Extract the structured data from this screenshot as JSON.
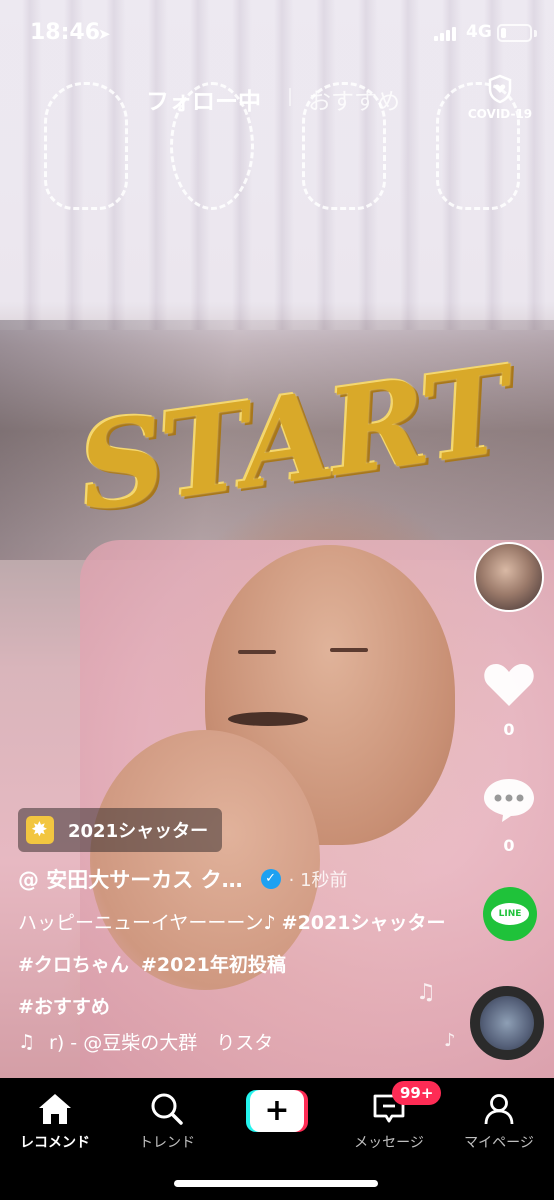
{
  "status_bar": {
    "time": "18:46",
    "network": "4G",
    "battery_level": 0.2
  },
  "top_tabs": {
    "following": "フォロー中",
    "for_you": "おすすめ"
  },
  "covid_button": {
    "label": "COVID-19"
  },
  "video": {
    "overlay_text": "START"
  },
  "actions": {
    "like_count": "0",
    "comment_count": "0",
    "share_app": "LINE"
  },
  "post": {
    "effect_label": "2021シャッター",
    "username": "@ 安田大サーカス ク…",
    "time_ago": "· 1秒前",
    "caption_text": "ハッピーニューイヤーーーン♪",
    "hashtags": [
      "#2021シャッター",
      "#クロちゃん",
      "#2021年初投稿",
      "#おすすめ"
    ],
    "sound": "r) - @豆柴の大群　りスタ"
  },
  "bottom_nav": {
    "home": "レコメンド",
    "discover": "トレンド",
    "inbox": "メッセージ",
    "profile": "マイページ",
    "inbox_badge": "99+"
  },
  "colors": {
    "like": "#ffffff",
    "line_green": "#1fc23a",
    "badge_red": "#fe2c55",
    "verified_blue": "#1da1f2",
    "start_gold": "#d9a929"
  }
}
